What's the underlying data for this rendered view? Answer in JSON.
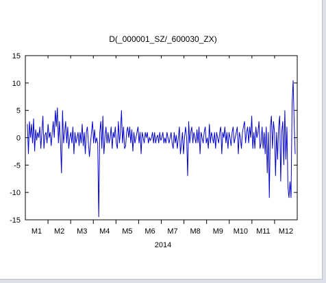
{
  "chart_data": {
    "type": "line",
    "title": "D(_000001_SZ/_600030_ZX)",
    "xlabel": "2014",
    "ylabel": "",
    "ylim": [
      -15,
      15
    ],
    "yticks": [
      -15,
      -10,
      -5,
      0,
      5,
      10,
      15
    ],
    "month_labels": [
      "M1",
      "M2",
      "M3",
      "M4",
      "M5",
      "M6",
      "M7",
      "M8",
      "M9",
      "M10",
      "M11",
      "M12"
    ],
    "grid": false,
    "legend": "none",
    "line_color": "#0000cc",
    "series": [
      {
        "values": [
          2.5,
          -3,
          3,
          0,
          2.5,
          -1,
          3.5,
          -2.5,
          1.5,
          -0.5,
          1,
          0,
          2,
          -2,
          1,
          4,
          -2,
          0.5,
          1,
          -1,
          2.5,
          0,
          1,
          -1.5,
          1,
          3,
          0,
          5,
          2,
          5.5,
          -1,
          3,
          -1,
          -6.5,
          5,
          -1,
          1,
          3,
          -1,
          2,
          -2,
          0,
          1,
          -1,
          2,
          -3,
          1,
          -1,
          0,
          1,
          -1.5,
          1,
          -1,
          2.5,
          -1.5,
          1,
          -3,
          1,
          2,
          -1,
          -3.5,
          -1,
          1,
          3,
          -1,
          1.5,
          -1,
          0,
          -1,
          -14.5,
          1,
          3,
          -2,
          4,
          -3,
          0,
          2,
          -1,
          1,
          -1,
          0,
          2,
          -2,
          1,
          0,
          2,
          -1,
          -2,
          3,
          -1,
          1,
          5,
          -1,
          2,
          -2,
          -1.5,
          1,
          2,
          0,
          2,
          -1,
          1.5,
          -2.5,
          1,
          -1,
          0,
          1,
          2,
          -1,
          1,
          -3,
          1,
          0,
          -1,
          1,
          0,
          1,
          -1,
          0,
          -0.5,
          0,
          1,
          -1,
          1,
          -1,
          0,
          0.5,
          -1,
          1,
          -0.5,
          0,
          1,
          -1,
          0,
          -1,
          1,
          0,
          -1,
          0,
          1,
          -1,
          -2,
          1,
          -1,
          0.5,
          -2,
          0,
          2,
          -3,
          -1,
          1,
          -3,
          0,
          2,
          0,
          -7,
          3,
          -1,
          1,
          2,
          -1,
          1,
          0,
          -1,
          1.5,
          -1,
          2,
          -3,
          1,
          0,
          -1,
          1,
          2,
          -1,
          0,
          -2,
          2.5,
          -1,
          1,
          0,
          -1,
          1,
          -2,
          1,
          0,
          -1,
          1,
          2,
          -3,
          1,
          0,
          2,
          -1,
          1,
          -2,
          1,
          0,
          -1.5,
          1,
          2,
          -1,
          0,
          1,
          2,
          -3,
          1,
          0,
          -2,
          1,
          2,
          3,
          -1,
          1,
          2,
          -1,
          2,
          0,
          4,
          -2,
          1,
          -2,
          2,
          0,
          1,
          3,
          -2,
          -1,
          2,
          -2,
          1,
          -3,
          2,
          -6.5,
          1,
          -11,
          2,
          4,
          -2,
          3,
          1,
          -7,
          1,
          -4,
          2,
          4,
          -8,
          1,
          3,
          -5,
          5,
          -4,
          2,
          -9,
          -11,
          -8,
          -11,
          6,
          10.5,
          3,
          -3
        ]
      }
    ]
  }
}
